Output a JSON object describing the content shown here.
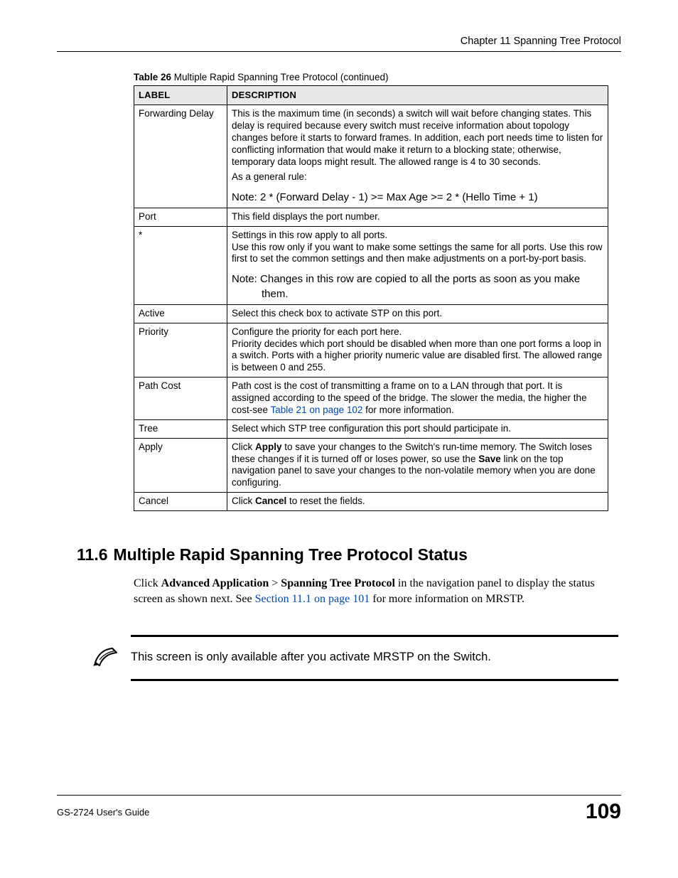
{
  "header": {
    "chapter": "Chapter 11 Spanning Tree Protocol"
  },
  "table_caption": {
    "bold": "Table 26",
    "rest": "   Multiple Rapid Spanning Tree Protocol (continued)"
  },
  "table": {
    "head": {
      "label": "Label",
      "desc": "Description"
    },
    "rows": [
      {
        "label": "Forwarding Delay",
        "desc": "This is the maximum time (in seconds) a switch will wait before changing states. This delay is required because every switch must receive information about topology changes before it starts to forward frames. In addition, each port needs time to listen for conflicting information that would make it return to a blocking state; otherwise, temporary data loops might result. The allowed range is 4 to 30 seconds.",
        "desc2": "As a general rule:",
        "note": "Note: 2 * (Forward Delay - 1) >= Max Age >= 2 * (Hello Time + 1)"
      },
      {
        "label": "Port",
        "desc": "This field displays the port number."
      },
      {
        "label": "*",
        "desc": "Settings in this row apply to all ports.",
        "desc2": "Use this row only if you want to make some settings the same for all ports. Use this row first to set the common settings and then make adjustments on a port-by-port basis.",
        "note": "Note: Changes in this row are copied to all the ports as soon as you make them."
      },
      {
        "label": "Active",
        "desc": "Select this check box to activate STP on this port."
      },
      {
        "label": "Priority",
        "desc": "Configure the priority for each port here.",
        "desc2": "Priority decides which port should be disabled when more than one port forms a loop in a switch. Ports with a higher priority numeric value are disabled first. The allowed range is between 0 and 255."
      },
      {
        "label": "Path Cost",
        "desc_pre": "Path cost is the cost of transmitting a frame on to a LAN through that port. It is assigned according to the speed of the bridge. The slower the media, the higher the cost-see ",
        "link": "Table 21 on page 102",
        "desc_post": " for more information."
      },
      {
        "label": "Tree",
        "desc": "Select which STP tree configuration this port should participate in."
      },
      {
        "label": "Apply",
        "desc_pre": "Click ",
        "b1": "Apply",
        "desc_mid": " to save your changes to the Switch's run-time memory. The Switch loses these changes if it is turned off or loses power, so use the ",
        "b2": "Save",
        "desc_post": " link on the top navigation panel to save your changes to the non-volatile memory when you are done configuring."
      },
      {
        "label": "Cancel",
        "desc_pre": "Click ",
        "b1": "Cancel",
        "desc_post": " to reset the fields."
      }
    ]
  },
  "section": {
    "num": "11.6",
    "title": "Multiple Rapid Spanning Tree Protocol Status"
  },
  "paragraph": {
    "p1_pre": "Click ",
    "p1_b1": "Advanced Application",
    "p1_gt": " > ",
    "p1_b2": "Spanning Tree Protocol",
    "p1_mid": " in the navigation panel to display the status screen as shown next. See ",
    "p1_link": "Section 11.1 on page 101",
    "p1_post": " for more information on MRSTP."
  },
  "note_block": {
    "text": "This screen is only available after you activate MRSTP on the Switch."
  },
  "footer": {
    "left": "GS-2724 User's Guide",
    "page": "109"
  }
}
